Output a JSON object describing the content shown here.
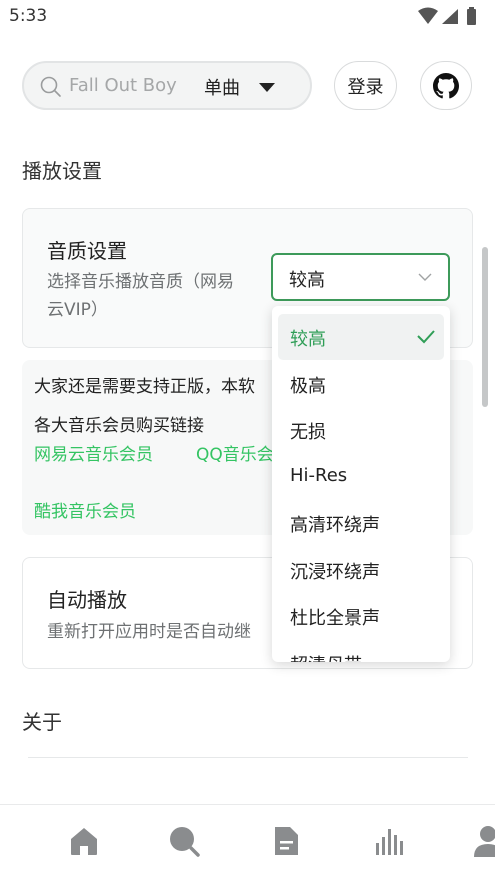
{
  "status_bar": {
    "time": "5:33"
  },
  "search": {
    "placeholder": "Fall Out Boy",
    "type_label": "单曲"
  },
  "header": {
    "login_label": "登录"
  },
  "sections": {
    "playback_title": "播放设置",
    "about_title": "关于"
  },
  "quality_card": {
    "title": "音质设置",
    "desc_line1": "选择音乐播放音质（网易",
    "desc_line2": "云VIP）",
    "selected": "较高"
  },
  "notice_card": {
    "line1": "大家还是需要支持正版，本软",
    "line2": "各大音乐会员购买链接",
    "link_netease": "网易云音乐会员",
    "link_qq": "QQ音乐会",
    "link_kuwo": "酷我音乐会员"
  },
  "autoplay_card": {
    "title": "自动播放",
    "desc": "重新打开应用时是否自动继"
  },
  "dropdown": {
    "options": [
      "较高",
      "极高",
      "无损",
      "Hi-Res",
      "高清环绕声",
      "沉浸环绕声",
      "杜比全景声",
      "超清母带"
    ]
  },
  "nav": {
    "items": [
      "home-icon",
      "search-icon",
      "document-icon",
      "chart-icon",
      "user-icon"
    ]
  },
  "colors": {
    "accent": "#34c463",
    "select_border": "#3d9a5a"
  }
}
